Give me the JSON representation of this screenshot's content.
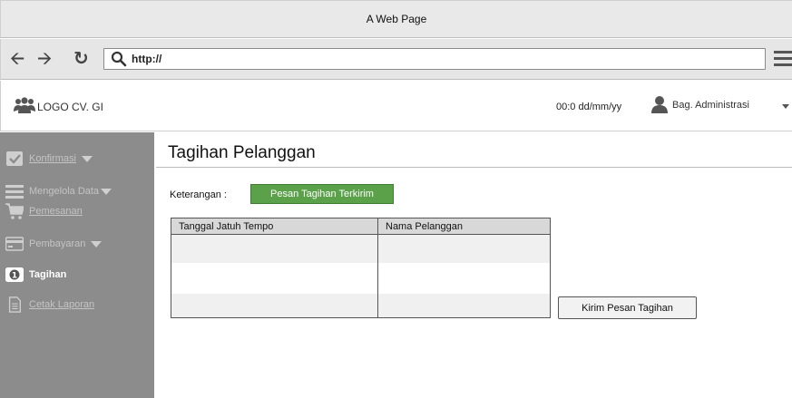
{
  "window": {
    "title": "A Web Page"
  },
  "browser": {
    "url": "http://"
  },
  "header": {
    "logo_text": "LOGO CV. GI",
    "date_text": "00:0 dd/mm/yy",
    "user_name": "Bag. Administrasi"
  },
  "sidebar": {
    "items": [
      {
        "label": "Konfirmasi",
        "icon": "checkbox-icon",
        "style": "link",
        "dropdown": true
      },
      {
        "label": "Mengelola Data",
        "icon": "list-icon",
        "style": "plain",
        "dropdown": true
      },
      {
        "label": "Pemesanan",
        "icon": "cart-icon",
        "style": "link",
        "dropdown": false
      },
      {
        "label": "Pembayaran",
        "icon": "credit-card-icon",
        "style": "plain",
        "dropdown": true
      },
      {
        "label": "Tagihan",
        "icon": "bill-icon",
        "style": "active",
        "dropdown": false
      },
      {
        "label": "Cetak Laporan",
        "icon": "document-icon",
        "style": "link",
        "dropdown": false
      }
    ]
  },
  "main": {
    "title": "Tagihan Pelanggan",
    "keterangan_label": "Keterangan :",
    "status_badge": "Pesan Tagihan Terkirim",
    "table": {
      "columns": [
        "Tanggal Jatuh Tempo",
        "Nama Pelanggan"
      ],
      "rows": [
        [
          "",
          ""
        ],
        [
          "",
          ""
        ],
        [
          "",
          ""
        ]
      ]
    },
    "send_button": "Kirim Pesan Tagihan"
  },
  "colors": {
    "sidebar_bg": "#8c8c8c",
    "badge_bg": "#5aa14a",
    "chrome_bg": "#e6e6e6"
  }
}
